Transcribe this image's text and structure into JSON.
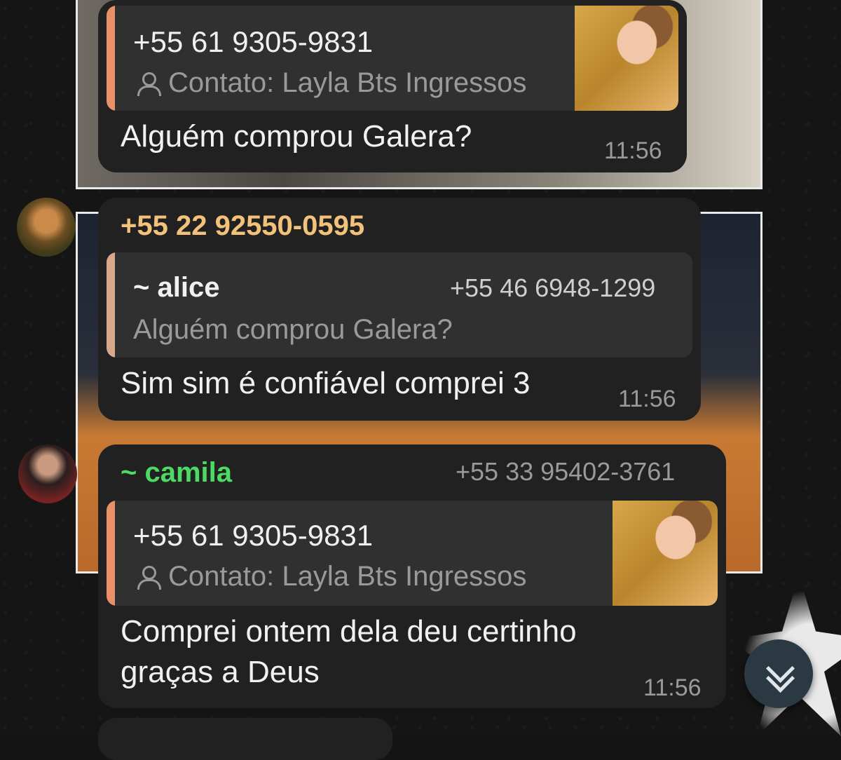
{
  "messages": [
    {
      "shared_contact": {
        "phone": "+55 61 9305-9831",
        "label": "Contato: Layla Bts Ingressos"
      },
      "text": "Alguém comprou Galera?",
      "time": "11:56"
    },
    {
      "sender_phone_name": "+55 22 92550-0595",
      "reply_to": {
        "name": "~ alice",
        "phone": "+55 46 6948-1299",
        "text": "Alguém comprou Galera?"
      },
      "text": "Sim sim é confiável comprei 3",
      "time": "11:56"
    },
    {
      "sender_name": "~ camila",
      "sender_phone": "+55 33 95402-3761",
      "shared_contact": {
        "phone": "+55 61 9305-9831",
        "label": "Contato: Layla Bts Ingressos"
      },
      "text_line1": "Comprei ontem dela deu certinho",
      "text_line2": "graças a Deus",
      "time": "11:56"
    }
  ],
  "colors": {
    "bubble": "#212121",
    "quote_bg": "#303030",
    "contact_bar": "#e8906a",
    "reply_bar": "#d8a88a",
    "sender_orange": "#f3c27a",
    "sender_green": "#4cd964"
  },
  "icons": {
    "contact": "person-icon",
    "scroll": "double-chevron-down-icon"
  }
}
